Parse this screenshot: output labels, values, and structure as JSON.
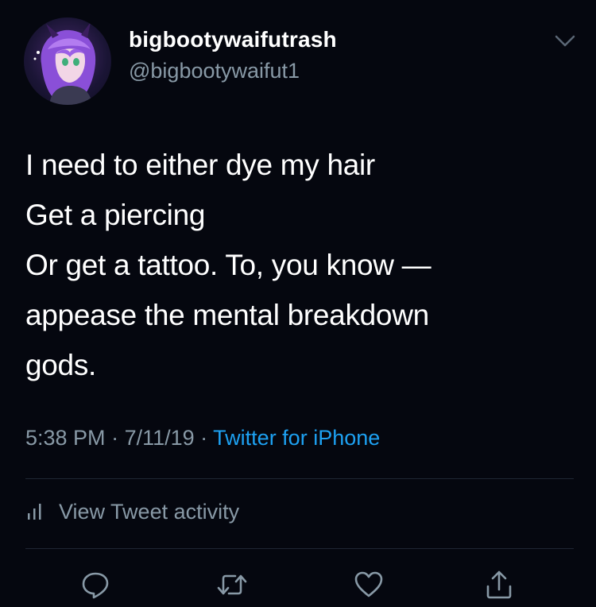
{
  "user": {
    "display_name": "bigbootywaifutrash",
    "handle": "@bigbootywaifut1"
  },
  "tweet": {
    "lines": [
      "I need to either dye my hair",
      "Get a piercing",
      "Or get a tattoo. To, you know —",
      "appease the mental breakdown",
      "gods."
    ]
  },
  "meta": {
    "time": "5:38 PM",
    "separator": " · ",
    "date": "7/11/19",
    "source": "Twitter for iPhone"
  },
  "activity": {
    "label": "View Tweet activity"
  },
  "icons": {
    "caret": "chevron-down-icon",
    "reply": "reply-icon",
    "retweet": "retweet-icon",
    "like": "heart-icon",
    "share": "share-icon",
    "activity": "bar-chart-icon"
  },
  "colors": {
    "background": "#05070f",
    "secondary_text": "#8899a6",
    "link": "#1da1f2"
  }
}
